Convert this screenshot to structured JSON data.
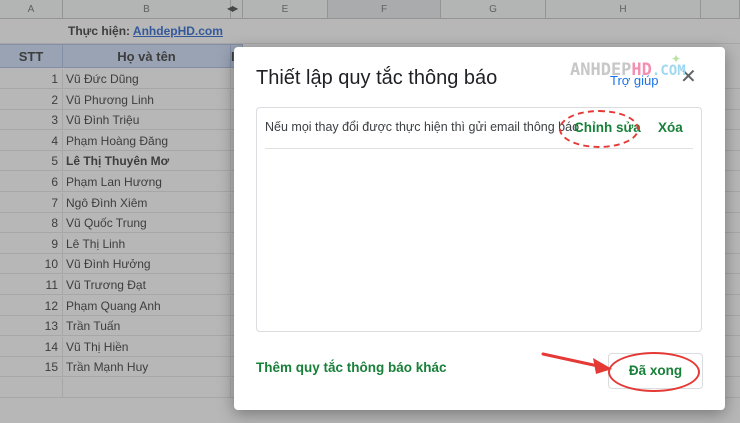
{
  "sheet": {
    "columns": [
      "A",
      "B",
      "",
      "E",
      "F",
      "G",
      "H"
    ],
    "credit_label": "Thực hiện: ",
    "credit_link": "AnhdepHD.com",
    "header_stt": "STT",
    "header_name": "Họ và tên",
    "header_next": "I",
    "rows": [
      {
        "stt": "1",
        "name": "Vũ Đức Dũng"
      },
      {
        "stt": "2",
        "name": "Vũ Phương Linh"
      },
      {
        "stt": "3",
        "name": "Vũ Đình Triệu"
      },
      {
        "stt": "4",
        "name": "Phạm Hoàng Đăng"
      },
      {
        "stt": "5",
        "name": "Lê Thị Thuyên Mơ"
      },
      {
        "stt": "6",
        "name": "Phạm Lan Hương"
      },
      {
        "stt": "7",
        "name": "Ngô Đình Xiêm"
      },
      {
        "stt": "8",
        "name": "Vũ Quốc Trung"
      },
      {
        "stt": "9",
        "name": "Lê Thị Linh"
      },
      {
        "stt": "10",
        "name": "Vũ Đình Hưởng"
      },
      {
        "stt": "11",
        "name": "Vũ Trương Đạt"
      },
      {
        "stt": "12",
        "name": "Phạm Quang Anh"
      },
      {
        "stt": "13",
        "name": "Trần Tuấn"
      },
      {
        "stt": "14",
        "name": "Vũ Thị Hiền"
      },
      {
        "stt": "15",
        "name": "Trần Mạnh Huy"
      }
    ]
  },
  "dialog": {
    "title": "Thiết lập quy tắc thông báo",
    "help": "Trợ giúp",
    "close_glyph": "✕",
    "rule_text": "Nếu mọi thay đổi được thực hiện thì gửi email thông báo",
    "edit_label": "Chỉnh sửa",
    "delete_label": "Xóa",
    "add_rule_label": "Thêm quy tắc thông báo khác",
    "done_label": "Đã xong"
  },
  "watermark": {
    "part1": "ANHDEP",
    "part2": "HD",
    "part3": ".COM"
  },
  "colors": {
    "header_fill": "#c9daf8",
    "accent_green": "#188038",
    "link_blue": "#1a73e8",
    "annotation_red": "#e53935"
  },
  "icons": {
    "close": "close-icon",
    "arrow": "red-arrow-annotation"
  }
}
